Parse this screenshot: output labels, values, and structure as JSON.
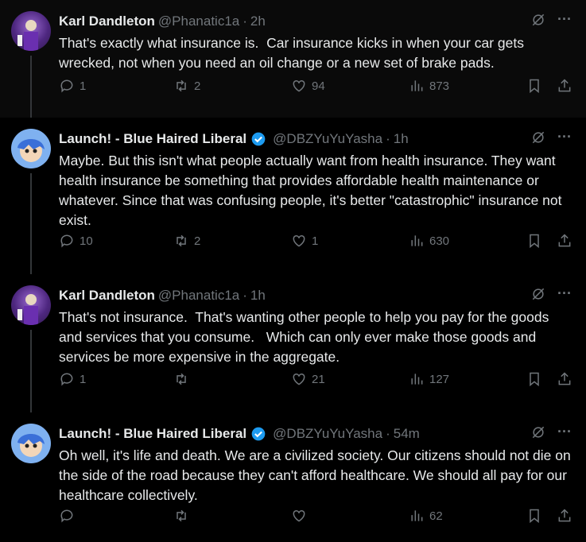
{
  "tweets": [
    {
      "name": "Karl Dandleton",
      "handle": "@Phanatic1a",
      "time": "2h",
      "verified": false,
      "text": "That's exactly what insurance is.  Car insurance kicks in when your car gets wrecked, not when you need an oil change or a new set of brake pads.",
      "replies": "1",
      "retweets": "2",
      "likes": "94",
      "views": "873"
    },
    {
      "name": "Launch! - Blue Haired Liberal",
      "handle": "@DBZYuYuYasha",
      "time": "1h",
      "verified": true,
      "text": "Maybe. But this isn't what people actually want from health insurance. They want health insurance be something that provides affordable health maintenance or whatever. Since that was confusing people, it's better \"catastrophic\" insurance not exist.",
      "replies": "10",
      "retweets": "2",
      "likes": "1",
      "views": "630"
    },
    {
      "name": "Karl Dandleton",
      "handle": "@Phanatic1a",
      "time": "1h",
      "verified": false,
      "text": "That's not insurance.  That's wanting other people to help you pay for the goods and services that you consume.   Which can only ever make those goods and services be more expensive in the aggregate.",
      "replies": "1",
      "retweets": "",
      "likes": "21",
      "views": "127"
    },
    {
      "name": "Launch! - Blue Haired Liberal",
      "handle": "@DBZYuYuYasha",
      "time": "54m",
      "verified": true,
      "text": "Oh well, it's life and death. We are a civilized society. Our citizens should not die on the side of the road because they can't afford healthcare. We should all pay for our healthcare collectively.",
      "replies": "",
      "retweets": "",
      "likes": "",
      "views": "62"
    }
  ],
  "dot": "·",
  "more_icon": "···",
  "colors": {
    "bg": "#000000",
    "text": "#e7e9ea",
    "muted": "#71767b",
    "verified": "#1d9bf0"
  }
}
